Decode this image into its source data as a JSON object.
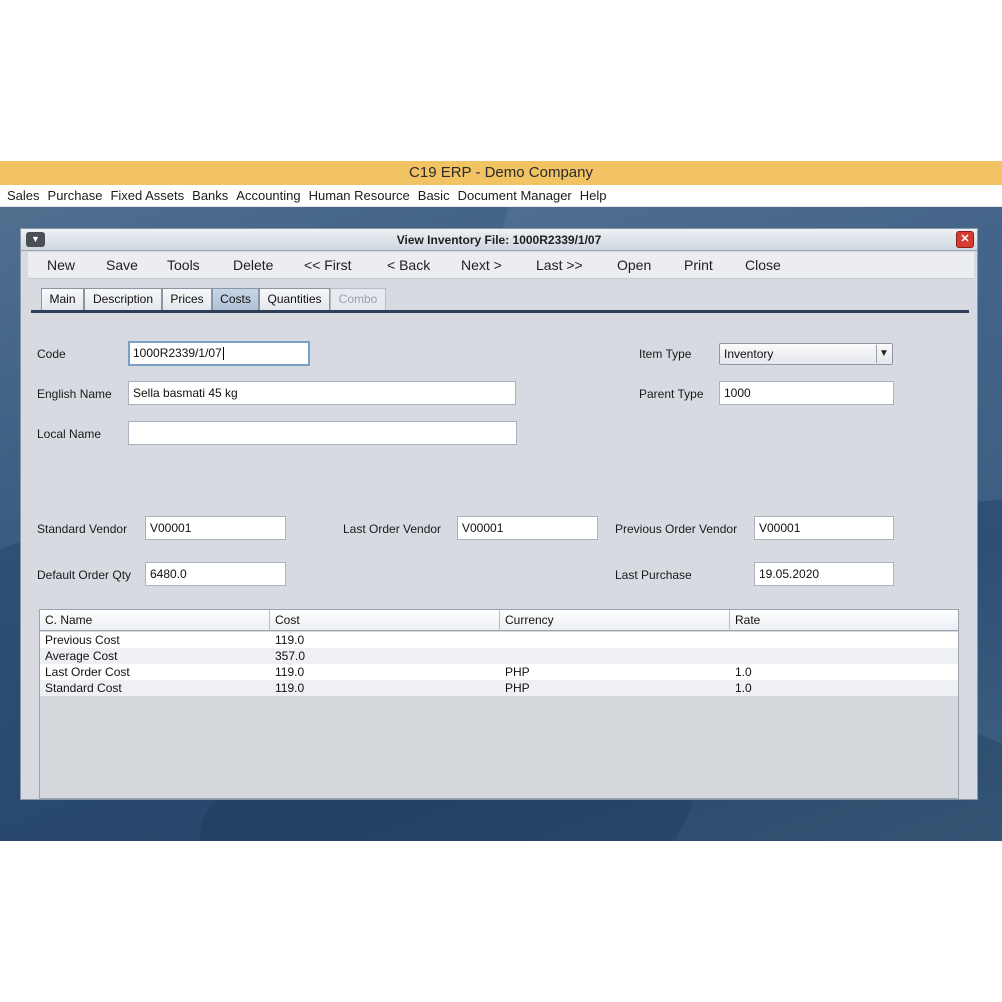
{
  "app": {
    "title": "C19 ERP - Demo Company"
  },
  "menu": [
    "Sales",
    "Purchase",
    "Fixed Assets",
    "Banks",
    "Accounting",
    "Human Resource",
    "Basic",
    "Document Manager",
    "Help"
  ],
  "window": {
    "title": "View Inventory File: 1000R2339/1/07",
    "menu_icon": "dropdown-triangle-icon",
    "close_icon": "close-x-icon"
  },
  "toolbar": {
    "new": "New",
    "save": "Save",
    "tools": "Tools",
    "delete": "Delete",
    "first": "<< First",
    "back": "< Back",
    "next": "Next >",
    "last": "Last >>",
    "open": "Open",
    "print": "Print",
    "close": "Close"
  },
  "tabs": [
    {
      "label": "Main"
    },
    {
      "label": "Description"
    },
    {
      "label": "Prices"
    },
    {
      "label": "Costs",
      "active": true
    },
    {
      "label": "Quantities"
    },
    {
      "label": "Combo",
      "disabled": true
    }
  ],
  "form": {
    "code_label": "Code",
    "code_value": "1000R2339/1/07",
    "english_name_label": "English Name",
    "english_name_value": "Sella basmati 45 kg",
    "local_name_label": "Local Name",
    "local_name_value": "",
    "item_type_label": "Item Type",
    "item_type_value": "Inventory",
    "parent_type_label": "Parent Type",
    "parent_type_value": "1000",
    "standard_vendor_label": "Standard Vendor",
    "standard_vendor_value": "V00001",
    "last_order_vendor_label": "Last Order Vendor",
    "last_order_vendor_value": "V00001",
    "previous_order_vendor_label": "Previous Order Vendor",
    "previous_order_vendor_value": "V00001",
    "default_order_qty_label": "Default Order Qty",
    "default_order_qty_value": "6480.0",
    "last_purchase_label": "Last Purchase",
    "last_purchase_value": "19.05.2020"
  },
  "costs_table": {
    "headers": [
      "C. Name",
      "Cost",
      "Currency",
      "Rate"
    ],
    "rows": [
      [
        "Previous Cost",
        "119.0",
        "",
        ""
      ],
      [
        "Average Cost",
        "357.0",
        "",
        ""
      ],
      [
        "Last Order Cost",
        "119.0",
        "PHP",
        "1.0"
      ],
      [
        "Standard Cost",
        "119.0",
        "PHP",
        "1.0"
      ]
    ]
  },
  "colors": {
    "title_bar": "#f1c363",
    "desktop": "#35587e",
    "window_bg": "#d7dbe1",
    "active_tab": "#aebfd4",
    "close_button": "#d53b2f"
  }
}
